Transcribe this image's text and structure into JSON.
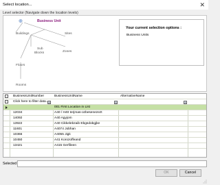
{
  "window": {
    "title": "Select location...",
    "close_glyph": "✕"
  },
  "selector": {
    "label": "Level selector (Navigate down the location levels)",
    "current_node": "Business Unit",
    "nodes": {
      "buildings": "Buildings",
      "sites": "Sites",
      "subblocks_line1": "Sub",
      "subblocks_line2": "Blocks",
      "zones": "Zones",
      "floors": "Floors",
      "rooms": "Rooms"
    }
  },
  "selection_box": {
    "heading": "Your current selection options :",
    "value": "Business Units"
  },
  "grid": {
    "columns": [
      "BusinessUnitNumber",
      "BusinessUnitName",
      "AlternativeName"
    ],
    "filter_placeholder": "Click here to filter data...",
    "filter_icon": "A",
    "selected_row_index": 0,
    "rows": [
      [
        "",
        "001 First Location in List",
        ""
      ],
      [
        "12034",
        "A40 / H40 terjmas-ozbesenezezt",
        ""
      ],
      [
        "14092",
        "A40 Agyjom",
        ""
      ],
      [
        "13922",
        "A40 Cikkelebzaib Ebgsdobgjke",
        ""
      ],
      [
        "11601",
        "A4074 Jobhan",
        ""
      ],
      [
        "10366",
        "A4055 Jigk",
        ""
      ],
      [
        "10450",
        "A41 Korozoffeand",
        ""
      ],
      [
        "13421",
        "A415 Gerfileen",
        ""
      ]
    ]
  },
  "footer": {
    "selected_label": "Selected",
    "selected_value": "",
    "ok_label": "OK",
    "cancel_label": "Cancel"
  },
  "colors": {
    "current_node": "#8a1c7c",
    "selected_row": "#c5e0a5",
    "grid_border": "#a9a9a9"
  },
  "icons": {
    "node_icon": "location-tree-icon",
    "filter_icon": "filter-icon",
    "row_indicator": "current-row-arrow-icon"
  }
}
